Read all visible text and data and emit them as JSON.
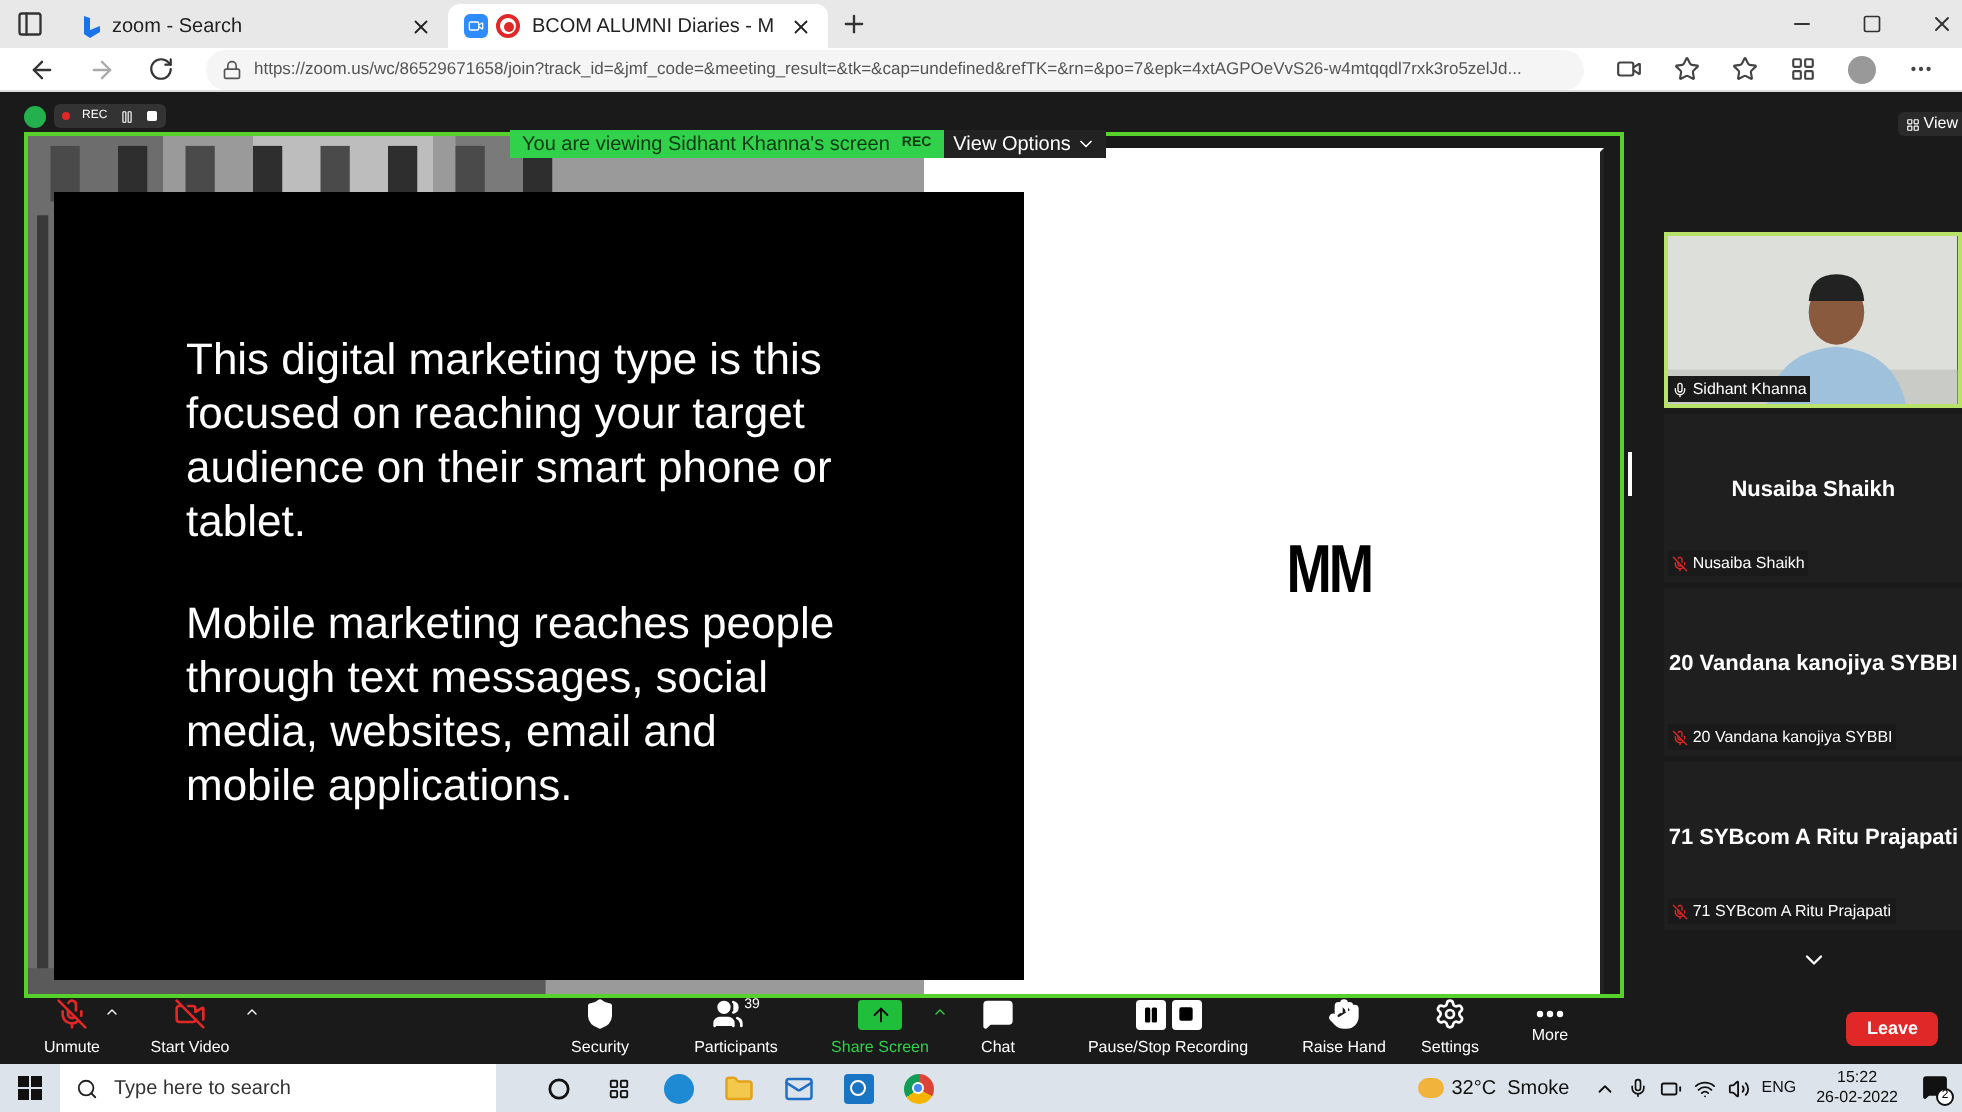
{
  "browser": {
    "tabs": [
      {
        "title": "zoom - Search",
        "kind": "search",
        "selected": false
      },
      {
        "title": "BCOM ALUMNI Diaries - M",
        "kind": "meeting",
        "selected": true
      }
    ],
    "url": "https://zoom.us/wc/86529671658/join?track_id=&jmf_code=&meeting_result=&tk=&cap=undefined&refTK=&rn=&po=7&epk=4xtAGPOeVvS26-w4mtqqdl7rxk3ro5zelJd..."
  },
  "meeting": {
    "rec_label": "REC",
    "banner": "You are viewing Sidhant Khanna's screen",
    "banner_rec": "REC",
    "view_options": "View Options",
    "view_button": "View",
    "slide": {
      "paragraphs": [
        "This digital marketing type is this focused on reaching your target audience on their smart phone or tablet.",
        "Mobile marketing reaches people through text messages, social media, websites, email and mobile applications."
      ],
      "logo": "MM"
    },
    "participants": [
      {
        "kind": "video",
        "name": "Sidhant Khanna",
        "muted": false,
        "active": true
      },
      {
        "kind": "name",
        "display": "Nusaiba Shaikh",
        "name": "Nusaiba Shaikh",
        "muted": true,
        "active": false
      },
      {
        "kind": "name",
        "display": "20 Vandana kanojiya SYBBI",
        "name": "20 Vandana kanojiya SYBBI",
        "muted": true,
        "active": false
      },
      {
        "kind": "name",
        "display": "71 SYBcom A Ritu Prajapati",
        "name": "71 SYBcom A Ritu Prajapati",
        "muted": true,
        "active": false
      }
    ]
  },
  "toolbar": {
    "items": [
      {
        "kind": "mic",
        "label": "Unmute",
        "caret": true
      },
      {
        "kind": "video",
        "label": "Start Video",
        "caret": true
      },
      {
        "kind": "security",
        "label": "Security",
        "caret": false
      },
      {
        "kind": "participants",
        "label": "Participants",
        "badge": "39",
        "caret": false
      },
      {
        "kind": "share",
        "label": "Share Screen",
        "caret": true
      },
      {
        "kind": "chat",
        "label": "Chat",
        "caret": false
      },
      {
        "kind": "recording",
        "label": "Pause/Stop Recording",
        "caret": false
      },
      {
        "kind": "hand",
        "label": "Raise Hand",
        "caret": false
      },
      {
        "kind": "settings",
        "label": "Settings",
        "caret": false
      },
      {
        "kind": "more",
        "label": "More",
        "caret": false
      }
    ],
    "leave": "Leave"
  },
  "taskbar": {
    "search_placeholder": "Type here to search",
    "weather": "32°C  Smoke",
    "language": "ENG",
    "time": "15:22",
    "date": "26-02-2022",
    "notifications": "2"
  }
}
